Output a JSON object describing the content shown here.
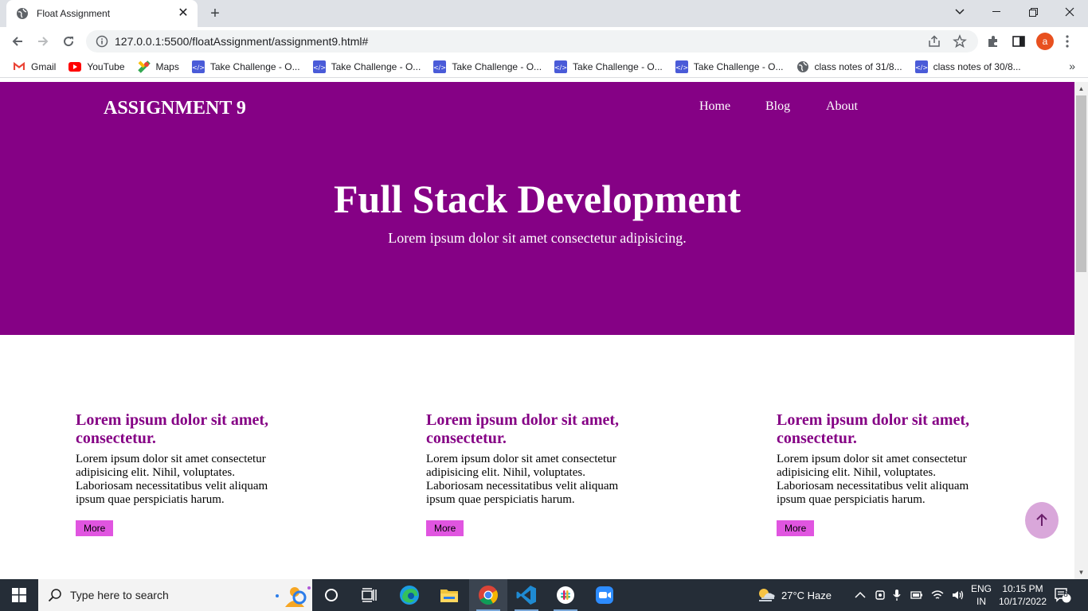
{
  "browser": {
    "tab_title": "Float Assignment",
    "url": "127.0.0.1:5500/floatAssignment/assignment9.html#",
    "profile_initial": "a",
    "bookmarks": [
      {
        "label": "Gmail",
        "icon": "gmail-icon"
      },
      {
        "label": "YouTube",
        "icon": "youtube-icon"
      },
      {
        "label": "Maps",
        "icon": "maps-icon"
      },
      {
        "label": "Take Challenge - O...",
        "icon": "code-icon"
      },
      {
        "label": "Take Challenge - O...",
        "icon": "code-icon"
      },
      {
        "label": "Take Challenge - O...",
        "icon": "code-icon"
      },
      {
        "label": "Take Challenge - O...",
        "icon": "code-icon"
      },
      {
        "label": "Take Challenge - O...",
        "icon": "code-icon"
      },
      {
        "label": "class notes of 31/8...",
        "icon": "globe-icon"
      },
      {
        "label": "class notes of 30/8...",
        "icon": "code-icon"
      }
    ]
  },
  "page": {
    "brand": "ASSIGNMENT 9",
    "nav": [
      "Home",
      "Blog",
      "About"
    ],
    "hero_title": "Full Stack Development",
    "hero_subtitle": "Lorem ipsum dolor sit amet consectetur adipisicing.",
    "cards": [
      {
        "heading": "Lorem ipsum dolor sit amet, consectetur.",
        "body": "Lorem ipsum dolor sit amet consectetur adipisicing elit. Nihil, voluptates. Laboriosam necessitatibus velit aliquam ipsum quae perspiciatis harum.",
        "button": "More"
      },
      {
        "heading": "Lorem ipsum dolor sit amet, consectetur.",
        "body": "Lorem ipsum dolor sit amet consectetur adipisicing elit. Nihil, voluptates. Laboriosam necessitatibus velit aliquam ipsum quae perspiciatis harum.",
        "button": "More"
      },
      {
        "heading": "Lorem ipsum dolor sit amet, consectetur.",
        "body": "Lorem ipsum dolor sit amet consectetur adipisicing elit. Nihil, voluptates. Laboriosam necessitatibus velit aliquam ipsum quae perspiciatis harum.",
        "button": "More"
      }
    ]
  },
  "taskbar": {
    "search_placeholder": "Type here to search",
    "weather": "27°C  Haze",
    "lang_top": "ENG",
    "lang_bottom": "IN",
    "time": "10:15 PM",
    "date": "10/17/2022",
    "notification_count": "8"
  },
  "colors": {
    "hero_bg": "#850185",
    "card_heading": "#850185",
    "more_button": "#e055e0",
    "to_top_button": "#d9a7da"
  }
}
